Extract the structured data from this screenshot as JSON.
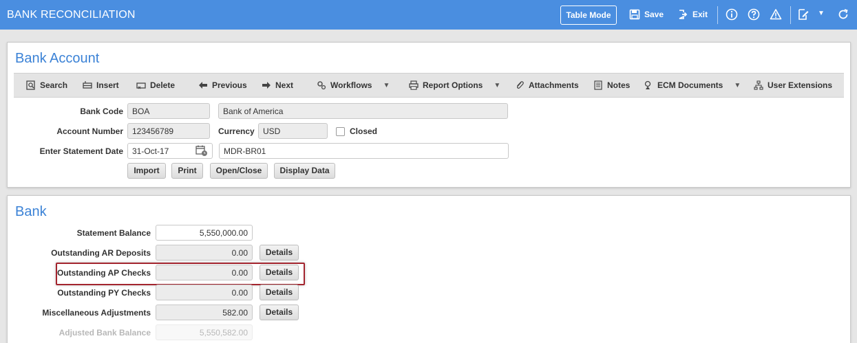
{
  "header": {
    "title": "BANK RECONCILIATION",
    "table_mode": "Table Mode",
    "save": "Save",
    "exit": "Exit"
  },
  "bank_account": {
    "title": "Bank Account",
    "toolbar": {
      "search": "Search",
      "insert": "Insert",
      "delete": "Delete",
      "previous": "Previous",
      "next": "Next",
      "workflows": "Workflows",
      "report_options": "Report Options",
      "attachments": "Attachments",
      "notes": "Notes",
      "ecm_documents": "ECM Documents",
      "user_extensions": "User Extensions"
    },
    "bank_code_label": "Bank Code",
    "bank_code": "BOA",
    "bank_name": "Bank of America",
    "account_number_label": "Account Number",
    "account_number": "123456789",
    "currency_label": "Currency",
    "currency": "USD",
    "closed_label": "Closed",
    "statement_date_label": "Enter Statement Date",
    "statement_date": "31-Oct-17",
    "statement_ref": "MDR-BR01",
    "buttons": {
      "import": "Import",
      "print": "Print",
      "open_close": "Open/Close",
      "display_data": "Display Data"
    }
  },
  "bank": {
    "title": "Bank",
    "statement_balance_label": "Statement Balance",
    "statement_balance": "5,550,000.00",
    "ar_deposits_label": "Outstanding AR Deposits",
    "ar_deposits": "0.00",
    "ap_checks_label": "Outstanding AP Checks",
    "ap_checks": "0.00",
    "py_checks_label": "Outstanding PY Checks",
    "py_checks": "0.00",
    "misc_adjustments_label": "Miscellaneous Adjustments",
    "misc_adjustments": "582.00",
    "adjusted_balance_label": "Adjusted Bank Balance",
    "adjusted_balance": "5,550,582.00",
    "details": "Details"
  },
  "colors": {
    "header_bg": "#4a8ee0",
    "title_blue": "#3b82d6",
    "highlight": "#a3242e"
  }
}
